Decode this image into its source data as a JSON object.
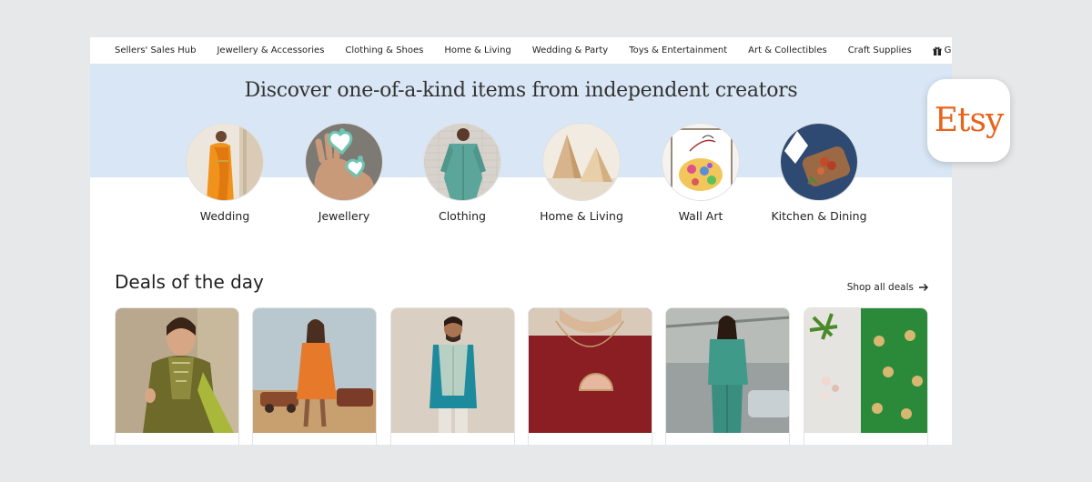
{
  "nav": {
    "items": [
      {
        "label": "Sellers' Sales Hub"
      },
      {
        "label": "Jewellery & Accessories"
      },
      {
        "label": "Clothing & Shoes"
      },
      {
        "label": "Home & Living"
      },
      {
        "label": "Wedding & Party"
      },
      {
        "label": "Toys & Entertainment"
      },
      {
        "label": "Art & Collectibles"
      },
      {
        "label": "Craft Supplies"
      },
      {
        "label": "Gifts",
        "icon": "gift-icon"
      }
    ]
  },
  "hero": {
    "title": "Discover one-of-a-kind items from independent creators"
  },
  "categories": [
    {
      "label": "Wedding"
    },
    {
      "label": "Jewellery"
    },
    {
      "label": "Clothing"
    },
    {
      "label": "Home & Living"
    },
    {
      "label": "Wall Art"
    },
    {
      "label": "Kitchen & Dining"
    }
  ],
  "deals": {
    "title": "Deals of the day",
    "shop_all": "Shop all deals",
    "items": 6
  },
  "badge": {
    "label": "Etsy"
  },
  "colors": {
    "hero_bg": "#d8e6f5",
    "brand": "#e8641d",
    "background": "#e7e8ea"
  }
}
